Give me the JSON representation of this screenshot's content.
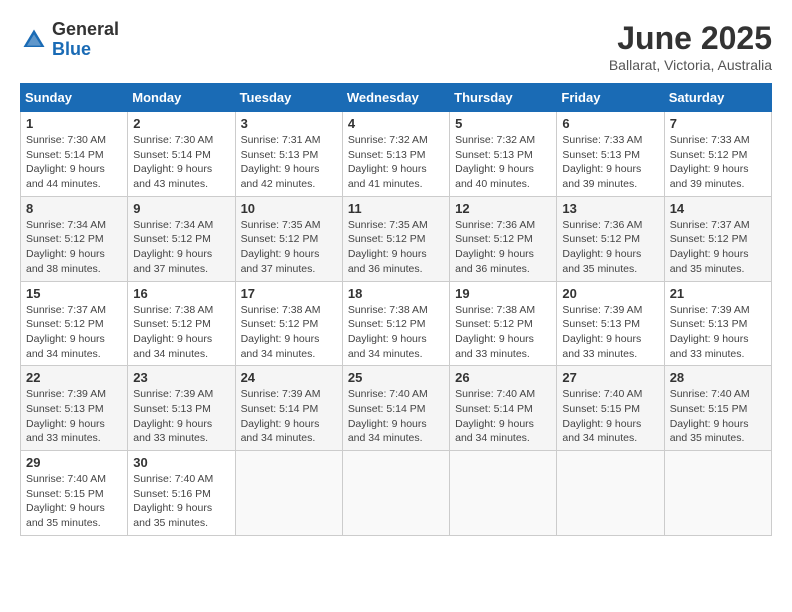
{
  "header": {
    "logo_general": "General",
    "logo_blue": "Blue",
    "month_title": "June 2025",
    "location": "Ballarat, Victoria, Australia"
  },
  "weekdays": [
    "Sunday",
    "Monday",
    "Tuesday",
    "Wednesday",
    "Thursday",
    "Friday",
    "Saturday"
  ],
  "weeks": [
    [
      {
        "day": "1",
        "sunrise": "7:30 AM",
        "sunset": "5:14 PM",
        "daylight": "9 hours and 44 minutes."
      },
      {
        "day": "2",
        "sunrise": "7:30 AM",
        "sunset": "5:14 PM",
        "daylight": "9 hours and 43 minutes."
      },
      {
        "day": "3",
        "sunrise": "7:31 AM",
        "sunset": "5:13 PM",
        "daylight": "9 hours and 42 minutes."
      },
      {
        "day": "4",
        "sunrise": "7:32 AM",
        "sunset": "5:13 PM",
        "daylight": "9 hours and 41 minutes."
      },
      {
        "day": "5",
        "sunrise": "7:32 AM",
        "sunset": "5:13 PM",
        "daylight": "9 hours and 40 minutes."
      },
      {
        "day": "6",
        "sunrise": "7:33 AM",
        "sunset": "5:13 PM",
        "daylight": "9 hours and 39 minutes."
      },
      {
        "day": "7",
        "sunrise": "7:33 AM",
        "sunset": "5:12 PM",
        "daylight": "9 hours and 39 minutes."
      }
    ],
    [
      {
        "day": "8",
        "sunrise": "7:34 AM",
        "sunset": "5:12 PM",
        "daylight": "9 hours and 38 minutes."
      },
      {
        "day": "9",
        "sunrise": "7:34 AM",
        "sunset": "5:12 PM",
        "daylight": "9 hours and 37 minutes."
      },
      {
        "day": "10",
        "sunrise": "7:35 AM",
        "sunset": "5:12 PM",
        "daylight": "9 hours and 37 minutes."
      },
      {
        "day": "11",
        "sunrise": "7:35 AM",
        "sunset": "5:12 PM",
        "daylight": "9 hours and 36 minutes."
      },
      {
        "day": "12",
        "sunrise": "7:36 AM",
        "sunset": "5:12 PM",
        "daylight": "9 hours and 36 minutes."
      },
      {
        "day": "13",
        "sunrise": "7:36 AM",
        "sunset": "5:12 PM",
        "daylight": "9 hours and 35 minutes."
      },
      {
        "day": "14",
        "sunrise": "7:37 AM",
        "sunset": "5:12 PM",
        "daylight": "9 hours and 35 minutes."
      }
    ],
    [
      {
        "day": "15",
        "sunrise": "7:37 AM",
        "sunset": "5:12 PM",
        "daylight": "9 hours and 34 minutes."
      },
      {
        "day": "16",
        "sunrise": "7:38 AM",
        "sunset": "5:12 PM",
        "daylight": "9 hours and 34 minutes."
      },
      {
        "day": "17",
        "sunrise": "7:38 AM",
        "sunset": "5:12 PM",
        "daylight": "9 hours and 34 minutes."
      },
      {
        "day": "18",
        "sunrise": "7:38 AM",
        "sunset": "5:12 PM",
        "daylight": "9 hours and 34 minutes."
      },
      {
        "day": "19",
        "sunrise": "7:38 AM",
        "sunset": "5:12 PM",
        "daylight": "9 hours and 33 minutes."
      },
      {
        "day": "20",
        "sunrise": "7:39 AM",
        "sunset": "5:13 PM",
        "daylight": "9 hours and 33 minutes."
      },
      {
        "day": "21",
        "sunrise": "7:39 AM",
        "sunset": "5:13 PM",
        "daylight": "9 hours and 33 minutes."
      }
    ],
    [
      {
        "day": "22",
        "sunrise": "7:39 AM",
        "sunset": "5:13 PM",
        "daylight": "9 hours and 33 minutes."
      },
      {
        "day": "23",
        "sunrise": "7:39 AM",
        "sunset": "5:13 PM",
        "daylight": "9 hours and 33 minutes."
      },
      {
        "day": "24",
        "sunrise": "7:39 AM",
        "sunset": "5:14 PM",
        "daylight": "9 hours and 34 minutes."
      },
      {
        "day": "25",
        "sunrise": "7:40 AM",
        "sunset": "5:14 PM",
        "daylight": "9 hours and 34 minutes."
      },
      {
        "day": "26",
        "sunrise": "7:40 AM",
        "sunset": "5:14 PM",
        "daylight": "9 hours and 34 minutes."
      },
      {
        "day": "27",
        "sunrise": "7:40 AM",
        "sunset": "5:15 PM",
        "daylight": "9 hours and 34 minutes."
      },
      {
        "day": "28",
        "sunrise": "7:40 AM",
        "sunset": "5:15 PM",
        "daylight": "9 hours and 35 minutes."
      }
    ],
    [
      {
        "day": "29",
        "sunrise": "7:40 AM",
        "sunset": "5:15 PM",
        "daylight": "9 hours and 35 minutes."
      },
      {
        "day": "30",
        "sunrise": "7:40 AM",
        "sunset": "5:16 PM",
        "daylight": "9 hours and 35 minutes."
      },
      null,
      null,
      null,
      null,
      null
    ]
  ],
  "labels": {
    "sunrise": "Sunrise:",
    "sunset": "Sunset:",
    "daylight": "Daylight:"
  }
}
